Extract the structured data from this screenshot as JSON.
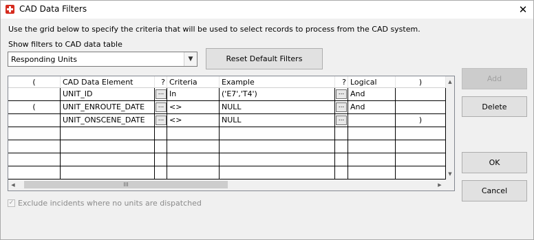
{
  "window": {
    "title": "CAD Data Filters",
    "close_glyph": "✕"
  },
  "instructions": "Use the grid below to specify the criteria that will be used to select records to process from the CAD system.",
  "table_label": "Show filters to CAD data table",
  "table_select": {
    "value": "Responding Units"
  },
  "buttons": {
    "reset": "Reset Default Filters",
    "add": "Add",
    "delete": "Delete",
    "ok": "OK",
    "cancel": "Cancel"
  },
  "grid": {
    "headers": {
      "open_paren": "(",
      "element": "CAD Data Element",
      "q1": "?",
      "criteria": "Criteria",
      "example": "Example",
      "q2": "?",
      "logical": "Logical",
      "close_paren": ")"
    },
    "button_glyph": "...",
    "rows": [
      {
        "open_paren": "",
        "element": "UNIT_ID",
        "criteria": "In",
        "example": "('E7','T4')",
        "logical": "And",
        "close_paren": ""
      },
      {
        "open_paren": "(",
        "element": "UNIT_ENROUTE_DATE",
        "criteria": "<>",
        "example": "NULL",
        "logical": "And",
        "close_paren": ""
      },
      {
        "open_paren": "",
        "element": "UNIT_ONSCENE_DATE",
        "criteria": "<>",
        "example": "NULL",
        "logical": "",
        "close_paren": ")"
      },
      {
        "open_paren": "",
        "element": "",
        "criteria": "",
        "example": "",
        "logical": "",
        "close_paren": ""
      },
      {
        "open_paren": "",
        "element": "",
        "criteria": "",
        "example": "",
        "logical": "",
        "close_paren": ""
      },
      {
        "open_paren": "",
        "element": "",
        "criteria": "",
        "example": "",
        "logical": "",
        "close_paren": ""
      },
      {
        "open_paren": "",
        "element": "",
        "criteria": "",
        "example": "",
        "logical": "",
        "close_paren": ""
      }
    ],
    "scroll_grip": "III"
  },
  "exclude_checkbox": {
    "label": "Exclude incidents where no units are dispatched",
    "checked": true,
    "enabled": false
  }
}
